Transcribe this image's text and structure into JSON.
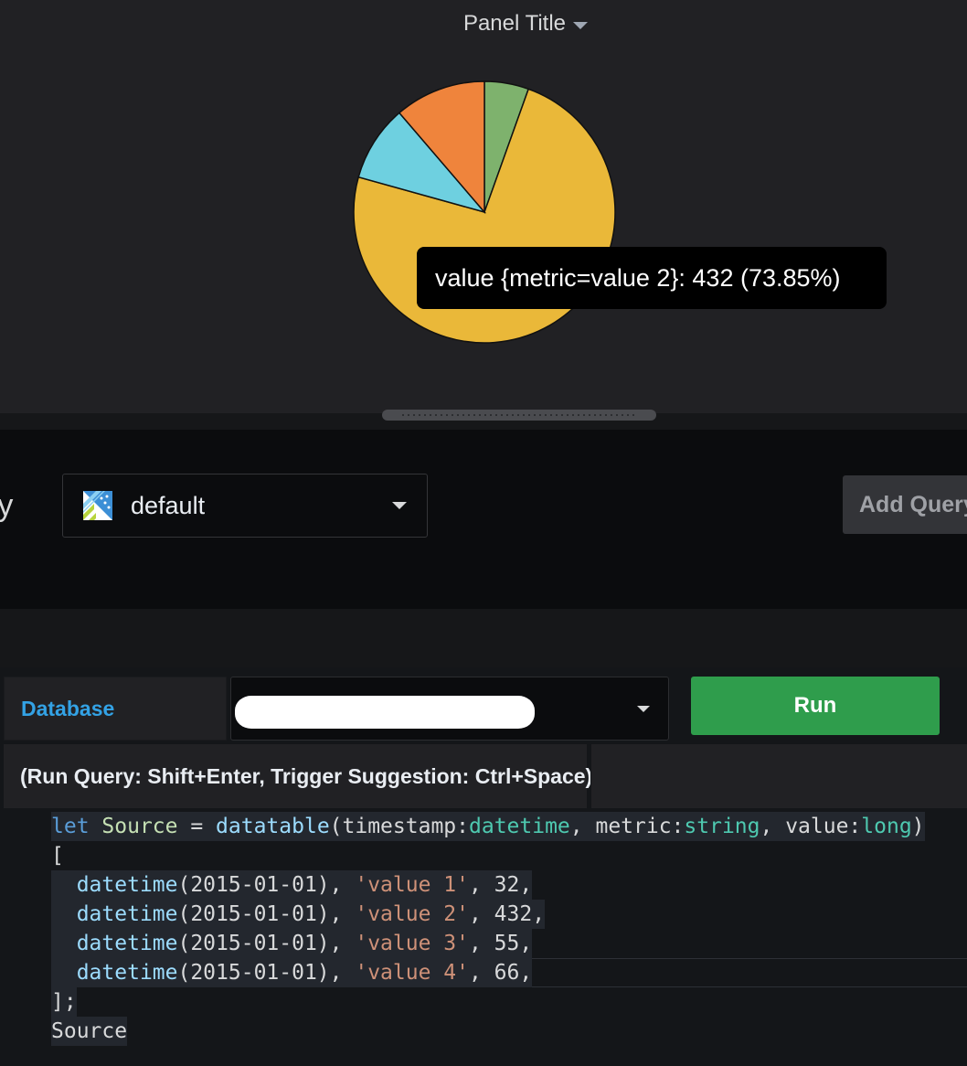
{
  "panel": {
    "title": "Panel Title",
    "tooltip": "value {metric=value 2}: 432 (73.85%)"
  },
  "chart_data": {
    "type": "pie",
    "categories": [
      "value 1",
      "value 2",
      "value 3",
      "value 4"
    ],
    "values": [
      32,
      432,
      55,
      66
    ],
    "colors": [
      "#7eb26d",
      "#eab839",
      "#6ed0e0",
      "#ef843c"
    ]
  },
  "query_editor": {
    "label": "ry",
    "datasource": "default",
    "add_query_label": "Add Query",
    "database_label": "Database",
    "run_label": "Run",
    "hint": "(Run Query: Shift+Enter, Trigger Suggestion: Ctrl+Space)"
  },
  "colors": {
    "run_button": "#2f9d4c",
    "database_label": "#33a2e5"
  }
}
